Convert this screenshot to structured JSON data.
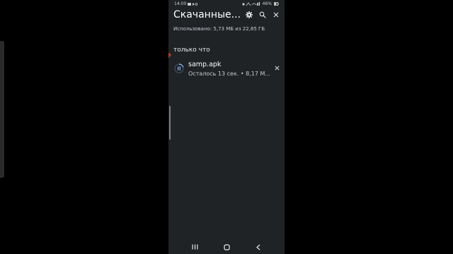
{
  "status_bar": {
    "time": "14:00",
    "battery": "46%"
  },
  "header": {
    "title": "Скачанные..."
  },
  "storage": {
    "text": "Использовано: 5,73 МБ из 22,85 ГБ"
  },
  "section": {
    "label": "только что"
  },
  "downloads": [
    {
      "name": "samp.apk",
      "status": "Осталось 13 сек. • 8,17 М...",
      "progress": 0.2
    }
  ],
  "icons": {
    "settings": "gear-icon",
    "search": "search-icon",
    "close": "close-icon",
    "pause": "pause-icon",
    "nav_recents": "recents-icon",
    "nav_home": "home-icon",
    "nav_back": "back-icon"
  },
  "colors": {
    "background": "#1f2326",
    "accent": "#8ab4f8"
  }
}
